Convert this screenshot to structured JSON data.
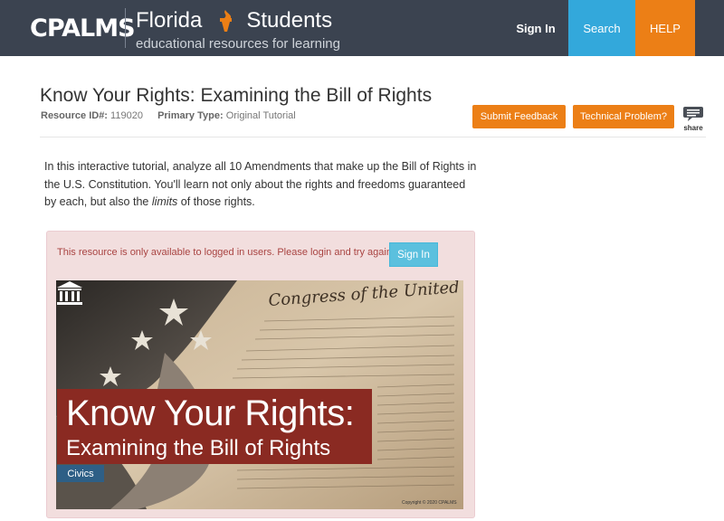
{
  "header": {
    "logo_text": "CPALMS",
    "brand_region": "Florida",
    "brand_audience": "Students",
    "tagline": "educational resources for learning",
    "nav": {
      "signin_label": "Sign In",
      "search_label": "Search",
      "help_label": "HELP"
    },
    "colors": {
      "bar": "#3b4350",
      "search": "#33a8db",
      "help": "#ec7f16"
    }
  },
  "resource": {
    "title": "Know Your Rights: Examining the Bill of Rights",
    "id_label": "Resource ID#:",
    "id_value": "119020",
    "type_label": "Primary Type:",
    "type_value": "Original Tutorial",
    "feedback_label": "Submit Feedback",
    "problem_label": "Technical Problem?",
    "share_label": "share",
    "description_part1": "In this interactive tutorial, analyze all 10 Amendments that make up the Bill of Rights in the U.S. Constitution.  You'll learn not only about the rights and freedoms guaranteed by each, but also the ",
    "description_emph": "limits",
    "description_part2": " of those rights."
  },
  "alert": {
    "message": "This resource is only available to logged in users. Please login and try again.",
    "signin_label": "Sign In"
  },
  "banner": {
    "title_line1": "Know Your Rights:",
    "title_line2": "Examining the Bill of Rights",
    "subject_badge": "Civics",
    "copyright": "Copyright © 2020 CPALMS",
    "document_heading": "Congress of the United States"
  }
}
